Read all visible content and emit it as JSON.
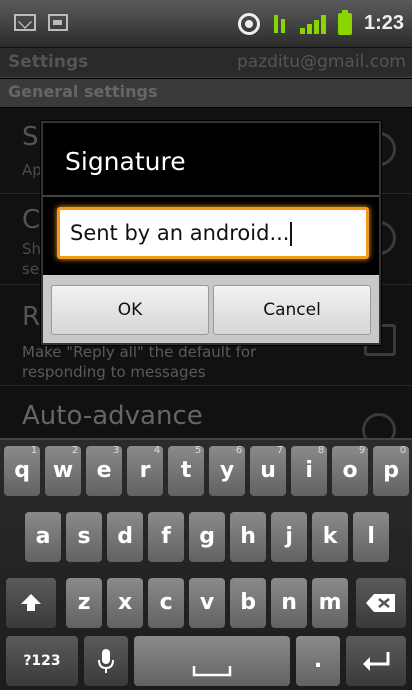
{
  "status_bar": {
    "time": "1:23",
    "icons": [
      "mail-icon",
      "document-icon",
      "gps-icon",
      "data-icon",
      "signal-icon",
      "battery-icon"
    ]
  },
  "titlebar": {
    "title": "Settings",
    "account": "pazditu@gmail.com"
  },
  "section": {
    "header": "General settings"
  },
  "settings_list": {
    "rows": [
      {
        "title": "Signature",
        "visible_title": "Si",
        "visible_sub": "Ap"
      },
      {
        "title": "C",
        "visible_sub1": "Sh",
        "visible_sub2": "se"
      },
      {
        "title": "R",
        "subtitle": "Make \"Reply all\" the default for",
        "subtitle2": "responding to messages"
      },
      {
        "title": "Auto-advance"
      }
    ]
  },
  "dialog": {
    "title": "Signature",
    "input_value": "Sent by an android...",
    "ok_label": "OK",
    "cancel_label": "Cancel"
  },
  "keyboard": {
    "row1": [
      {
        "k": "q",
        "n": "1"
      },
      {
        "k": "w",
        "n": "2"
      },
      {
        "k": "e",
        "n": "3"
      },
      {
        "k": "r",
        "n": "4"
      },
      {
        "k": "t",
        "n": "5"
      },
      {
        "k": "y",
        "n": "6"
      },
      {
        "k": "u",
        "n": "7"
      },
      {
        "k": "i",
        "n": "8"
      },
      {
        "k": "o",
        "n": "9"
      },
      {
        "k": "p",
        "n": "0"
      }
    ],
    "row2": [
      "a",
      "s",
      "d",
      "f",
      "g",
      "h",
      "j",
      "k",
      "l"
    ],
    "row3": [
      "z",
      "x",
      "c",
      "v",
      "b",
      "n",
      "m"
    ],
    "symbols_label": "?123",
    "period_label": ".",
    "shift_icon": "shift-icon",
    "delete_icon": "backspace-icon",
    "mic_icon": "microphone-icon",
    "space_icon": "space-icon",
    "enter_icon": "enter-icon"
  },
  "colors": {
    "input_focus": "#f39a1d",
    "status_green": "#8ad400"
  }
}
